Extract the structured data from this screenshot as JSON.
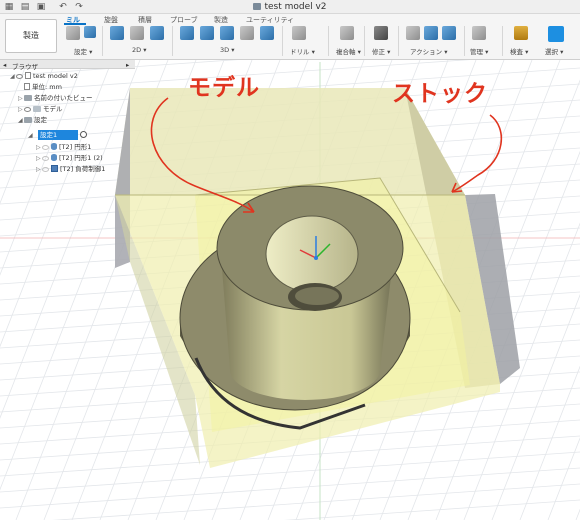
{
  "app": {
    "title": "test model v2"
  },
  "ribbon": {
    "workspace_label": "製造",
    "tabs": [
      {
        "label": "ミル",
        "active": true
      },
      {
        "label": "旋盤",
        "active": false
      },
      {
        "label": "積層",
        "active": false
      },
      {
        "label": "プローブ",
        "active": false
      },
      {
        "label": "製造",
        "active": false
      },
      {
        "label": "ユーティリティ",
        "active": false
      }
    ],
    "groups": [
      {
        "label": "設定 ▾"
      },
      {
        "label": "2D ▾"
      },
      {
        "label": "3D ▾"
      },
      {
        "label": "ドリル ▾"
      },
      {
        "label": "複合軸 ▾"
      },
      {
        "label": "修正 ▾"
      },
      {
        "label": "アクション ▾"
      },
      {
        "label": "管理 ▾"
      },
      {
        "label": "検査 ▾"
      },
      {
        "label": "選択 ▾"
      }
    ]
  },
  "browser": {
    "header": "ブラウザ",
    "nodes": [
      {
        "label": "test model v2"
      },
      {
        "label": "単位: mm"
      },
      {
        "label": "名前の付いたビュー"
      },
      {
        "label": "モデル"
      },
      {
        "label": "設定"
      },
      {
        "label": "設定1"
      },
      {
        "label": "[T2] 円形1"
      },
      {
        "label": "[T2] 円形1 (2)"
      },
      {
        "label": "[T2] 負荷制御1"
      }
    ]
  },
  "annotations": {
    "model": "モデル",
    "stock": "ストック",
    "color": "#e0341f"
  },
  "colors": {
    "accent": "#0a73c6",
    "stock_fill": "#eef0a8",
    "part": "#8e8b6b"
  }
}
